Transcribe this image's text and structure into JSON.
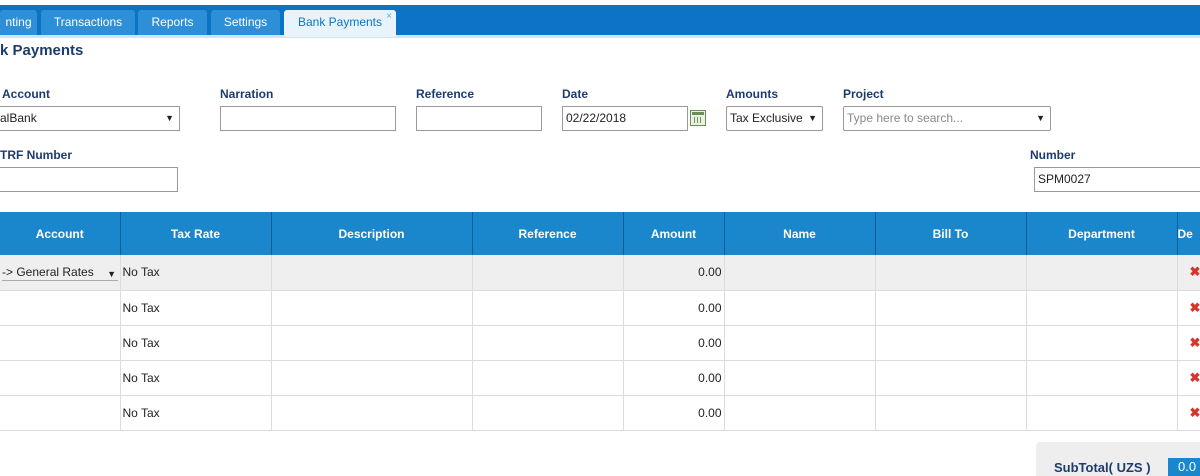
{
  "tabs": [
    {
      "label": "nting"
    },
    {
      "label": "Transactions"
    },
    {
      "label": "Reports"
    },
    {
      "label": "Settings"
    },
    {
      "label": "Bank Payments",
      "close": "×"
    }
  ],
  "page_title": "k Payments",
  "form": {
    "account_label": "Account",
    "account_value": "alBank",
    "narration_label": "Narration",
    "narration_value": "",
    "reference_label": "Reference",
    "reference_value": "",
    "date_label": "Date",
    "date_value": "02/22/2018",
    "amounts_label": "Amounts",
    "amounts_value": "Tax Exclusive",
    "project_label": "Project",
    "project_placeholder": "Type here to search...",
    "trf_label": "TRF Number",
    "trf_value": "",
    "number_label": "Number",
    "number_value": "SPM0027"
  },
  "grid": {
    "headers": [
      "Account",
      "Tax Rate",
      "Description",
      "Reference",
      "Amount",
      "Name",
      "Bill To",
      "Department",
      "De"
    ],
    "rows": [
      {
        "account": "-> General Rates",
        "tax_rate": "No Tax",
        "description": "",
        "reference": "",
        "amount": "0.00",
        "name": "",
        "bill_to": "",
        "department": ""
      },
      {
        "account": "",
        "tax_rate": "No Tax",
        "description": "",
        "reference": "",
        "amount": "0.00",
        "name": "",
        "bill_to": "",
        "department": ""
      },
      {
        "account": "",
        "tax_rate": "No Tax",
        "description": "",
        "reference": "",
        "amount": "0.00",
        "name": "",
        "bill_to": "",
        "department": ""
      },
      {
        "account": "",
        "tax_rate": "No Tax",
        "description": "",
        "reference": "",
        "amount": "0.00",
        "name": "",
        "bill_to": "",
        "department": ""
      },
      {
        "account": "",
        "tax_rate": "No Tax",
        "description": "",
        "reference": "",
        "amount": "0.00",
        "name": "",
        "bill_to": "",
        "department": ""
      }
    ],
    "delete_icon": "delete-icon"
  },
  "summary": {
    "subtotal_label": "SubTotal( UZS )",
    "subtotal_value": "0.0"
  },
  "colors": {
    "topbar": "#0b74c4",
    "grid_header": "#1a86cc",
    "label_text": "#1d3c6e",
    "delete": "#d9342b"
  }
}
